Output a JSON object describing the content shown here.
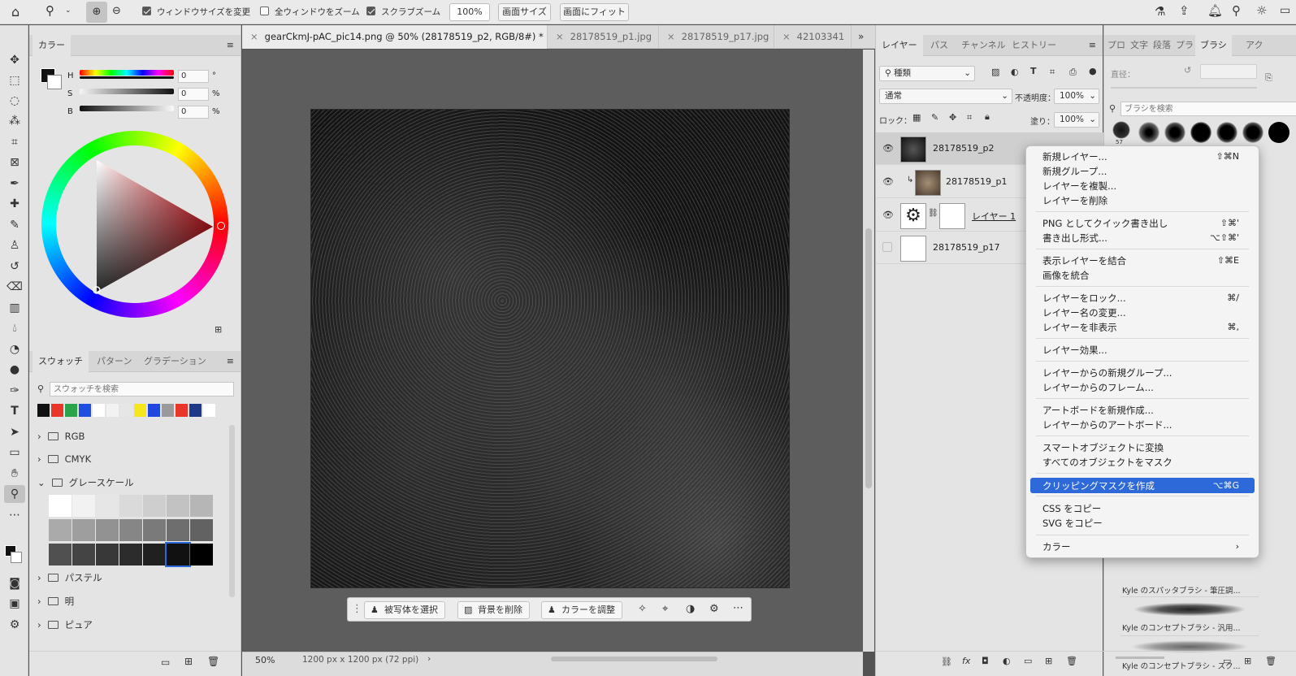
{
  "optbar": {
    "resize_windows_label": "ウィンドウサイズを変更",
    "zoom_all_label": "全ウィンドウをズーム",
    "scrubby_zoom_label": "スクラブズーム",
    "zoom_value": "100%",
    "screen_size_label": "画面サイズ",
    "fit_screen_label": "画面にフィット"
  },
  "color_panel": {
    "tab": "カラー",
    "h_label": "H",
    "s_label": "S",
    "b_label": "B",
    "h_value": "0",
    "s_value": "0",
    "b_value": "0",
    "h_unit": "°",
    "s_unit": "%",
    "b_unit": "%"
  },
  "swatch_panel": {
    "tabs": [
      "スウォッチ",
      "パターン",
      "グラデーション"
    ],
    "search_placeholder": "スウォッチを検索",
    "swatches": [
      "#111111",
      "#e8362a",
      "#2ba34a",
      "#1f4fe0",
      "#ffffff",
      "#f2f2f2",
      "#e6e6e6",
      "#f6e61c",
      "#2046e0",
      "#9a9a9a",
      "#e8362a",
      "#1d3a8a",
      "#ffffff"
    ],
    "groups": [
      "RGB",
      "CMYK",
      "グレースケール",
      "パステル",
      "明",
      "ピュア"
    ],
    "grayscale": [
      "#ffffff",
      "#f2f2f2",
      "#e6e6e6",
      "#dadada",
      "#cecece",
      "#c2c2c2",
      "#b6b6b6",
      "#aaaaaa",
      "#9e9e9e",
      "#929292",
      "#868686",
      "#7a7a7a",
      "#6e6e6e",
      "#626262",
      "#505050",
      "#444444",
      "#383838",
      "#2c2c2c",
      "#202020",
      "#111111",
      "#000000"
    ]
  },
  "doc_tabs": [
    "gearCkmJ-pAC_pic14.png @ 50% (28178519_p2, RGB/8#) *",
    "28178519_p1.jpg",
    "28178519_p17.jpg",
    "42103341"
  ],
  "taskbar": {
    "select_subject": "被写体を選択",
    "remove_bg": "背景を削除",
    "adjust_color": "カラーを調整"
  },
  "status": {
    "zoom": "50%",
    "doc_info": "1200 px x 1200 px (72 ppi)"
  },
  "layers_panel": {
    "tabs": [
      "レイヤー",
      "パス",
      "チャンネル",
      "ヒストリー"
    ],
    "filter_kind": "種類",
    "blend_mode": "通常",
    "opacity_label": "不透明度：",
    "opacity_value": "100%",
    "lock_label": "ロック：",
    "fill_label": "塗り：",
    "fill_value": "100%",
    "layers": [
      {
        "name": "28178519_p2",
        "visible": true
      },
      {
        "name": "28178519_p1",
        "visible": true
      },
      {
        "name": "レイヤー 1",
        "visible": true
      },
      {
        "name": "28178519_p17",
        "visible": false
      }
    ]
  },
  "brush_panel": {
    "tabs": [
      "プロ",
      "文字",
      "段落",
      "プラ",
      "ブラシ",
      "アク"
    ],
    "angle_label": "直径：",
    "search_placeholder": "ブラシを検索",
    "brush_size": "57",
    "brush_items": [
      "Kyle のスパッタブラシ - 筆圧調...",
      "Kyle のコンセプトブラシ - 汎用...",
      "Kyle のコンセプトブラシ - スク..."
    ]
  },
  "context_menu": {
    "groups": [
      [
        {
          "label": "新規レイヤー...",
          "shortcut": "⇧⌘N"
        },
        {
          "label": "新規グループ...",
          "shortcut": ""
        },
        {
          "label": "レイヤーを複製...",
          "shortcut": ""
        },
        {
          "label": "レイヤーを削除",
          "shortcut": ""
        }
      ],
      [
        {
          "label": "PNG としてクイック書き出し",
          "shortcut": "⇧⌘'"
        },
        {
          "label": "書き出し形式...",
          "shortcut": "⌥⇧⌘'"
        }
      ],
      [
        {
          "label": "表示レイヤーを結合",
          "shortcut": "⇧⌘E"
        },
        {
          "label": "画像を統合",
          "shortcut": ""
        }
      ],
      [
        {
          "label": "レイヤーをロック...",
          "shortcut": "⌘/"
        },
        {
          "label": "レイヤー名の変更...",
          "shortcut": ""
        },
        {
          "label": "レイヤーを非表示",
          "shortcut": "⌘,"
        }
      ],
      [
        {
          "label": "レイヤー効果...",
          "shortcut": ""
        }
      ],
      [
        {
          "label": "レイヤーからの新規グループ...",
          "shortcut": ""
        },
        {
          "label": "レイヤーからのフレーム...",
          "shortcut": ""
        }
      ],
      [
        {
          "label": "アートボードを新規作成...",
          "shortcut": ""
        },
        {
          "label": "レイヤーからのアートボード...",
          "shortcut": ""
        }
      ],
      [
        {
          "label": "スマートオブジェクトに変換",
          "shortcut": ""
        },
        {
          "label": "すべてのオブジェクトをマスク",
          "shortcut": ""
        }
      ],
      [
        {
          "label": "クリッピングマスクを作成",
          "shortcut": "⌥⌘G",
          "highlighted": true
        }
      ],
      [
        {
          "label": "CSS をコピー",
          "shortcut": ""
        },
        {
          "label": "SVG をコピー",
          "shortcut": ""
        }
      ],
      [
        {
          "label": "カラー",
          "shortcut": "›"
        }
      ]
    ]
  }
}
